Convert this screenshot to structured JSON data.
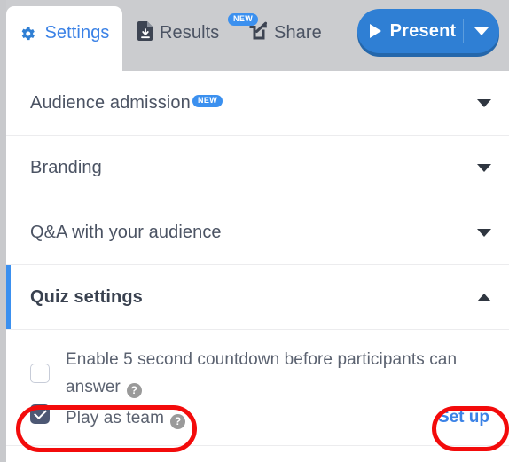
{
  "tabs": {
    "settings": {
      "label": "Settings",
      "icon": "gear-icon"
    },
    "results": {
      "label": "Results",
      "icon": "document-download-icon",
      "badge": "NEW"
    },
    "share": {
      "label": "Share",
      "icon": "share-icon"
    }
  },
  "present": {
    "label": "Present",
    "play_icon": "play-icon",
    "caret_icon": "chevron-down-icon",
    "color": "#2f7fd4",
    "shadow_color": "#2567ab"
  },
  "accordion": [
    {
      "title": "Audience admission",
      "badge": "NEW",
      "expanded": false,
      "caret": "chevron-down-icon"
    },
    {
      "title": "Branding",
      "badge": "",
      "expanded": false,
      "caret": "chevron-down-icon"
    },
    {
      "title": "Q&A with your audience",
      "badge": "",
      "expanded": false,
      "caret": "chevron-down-icon"
    },
    {
      "title": "Quiz settings",
      "badge": "",
      "expanded": true,
      "caret": "chevron-up-icon"
    }
  ],
  "quiz_settings": {
    "countdown": {
      "label": "Enable 5 second countdown before participants can answer",
      "checked": false,
      "help_icon": "help-circle-icon",
      "help_glyph": "?"
    },
    "play_as_team": {
      "label": "Play as team",
      "checked": true,
      "help_icon": "help-circle-icon",
      "help_glyph": "?",
      "checkbox_color": "#4d5874"
    },
    "setup_link": "Set up"
  },
  "annotations": {
    "color": "#f30b0b",
    "shapes": [
      {
        "name": "play-as-team-highlight",
        "target": "Play as team"
      },
      {
        "name": "set-up-highlight",
        "target": "Set up"
      }
    ]
  },
  "colors": {
    "accent_blue": "#3b90ef",
    "link_blue": "#3b82e6",
    "tabbar_grey": "#cbcccf",
    "text_grey": "#4b5363"
  }
}
